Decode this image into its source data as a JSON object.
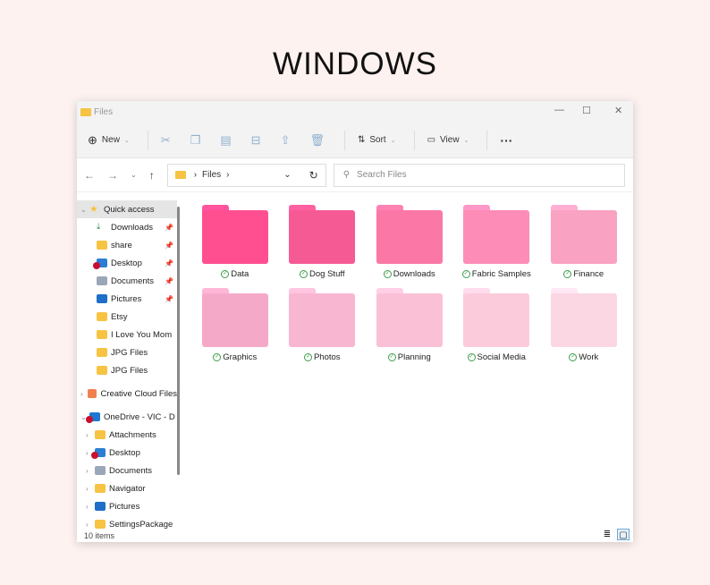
{
  "heading": "WINDOWS",
  "window": {
    "title": "Files"
  },
  "toolbar": {
    "new_label": "New",
    "sort_label": "Sort",
    "view_label": "View"
  },
  "address": {
    "path": "Files",
    "search_placeholder": "Search Files"
  },
  "sidebar": {
    "items": [
      {
        "label": "Quick access",
        "icon": "star-icon",
        "expand": "v"
      },
      {
        "label": "Downloads",
        "icon": "download-icon",
        "pinned": true
      },
      {
        "label": "share",
        "icon": "folder-icon",
        "pinned": true
      },
      {
        "label": "Desktop",
        "icon": "desktop-icon",
        "pinned": true,
        "error": true
      },
      {
        "label": "Documents",
        "icon": "documents-icon",
        "pinned": true
      },
      {
        "label": "Pictures",
        "icon": "pictures-icon",
        "pinned": true
      },
      {
        "label": "Etsy",
        "icon": "folder-icon"
      },
      {
        "label": "I Love You Mom",
        "icon": "folder-icon"
      },
      {
        "label": "JPG Files",
        "icon": "folder-icon"
      },
      {
        "label": "JPG Files",
        "icon": "folder-icon"
      },
      {
        "label": "Creative Cloud Files",
        "icon": "creative-cloud-icon",
        "expand": ">"
      },
      {
        "label": "OneDrive - VIC - D",
        "icon": "onedrive-icon",
        "expand": "v",
        "error": true
      },
      {
        "label": "Attachments",
        "icon": "folder-icon",
        "expand": ">"
      },
      {
        "label": "Desktop",
        "icon": "desktop-icon",
        "expand": ">",
        "error": true
      },
      {
        "label": "Documents",
        "icon": "documents-icon",
        "expand": ">"
      },
      {
        "label": "Navigator",
        "icon": "folder-icon",
        "expand": ">"
      },
      {
        "label": "Pictures",
        "icon": "pictures-icon",
        "expand": ">"
      },
      {
        "label": "SettingsPackage",
        "icon": "folder-icon",
        "expand": ">"
      }
    ]
  },
  "folders": [
    {
      "name": "Data",
      "color": "#ff4f91"
    },
    {
      "name": "Dog Stuff",
      "color": "#f55a95"
    },
    {
      "name": "Downloads",
      "color": "#fb78a6"
    },
    {
      "name": "Fabric Samples",
      "color": "#fd8db7"
    },
    {
      "name": "Finance",
      "color": "#f9a2c2"
    },
    {
      "name": "Graphics",
      "color": "#f5a9c8"
    },
    {
      "name": "Photos",
      "color": "#f8b6d0"
    },
    {
      "name": "Planning",
      "color": "#f9c0d6"
    },
    {
      "name": "Social Media",
      "color": "#fbcbdc"
    },
    {
      "name": "Work",
      "color": "#fbd6e3"
    }
  ],
  "status": {
    "count": "10 items"
  }
}
